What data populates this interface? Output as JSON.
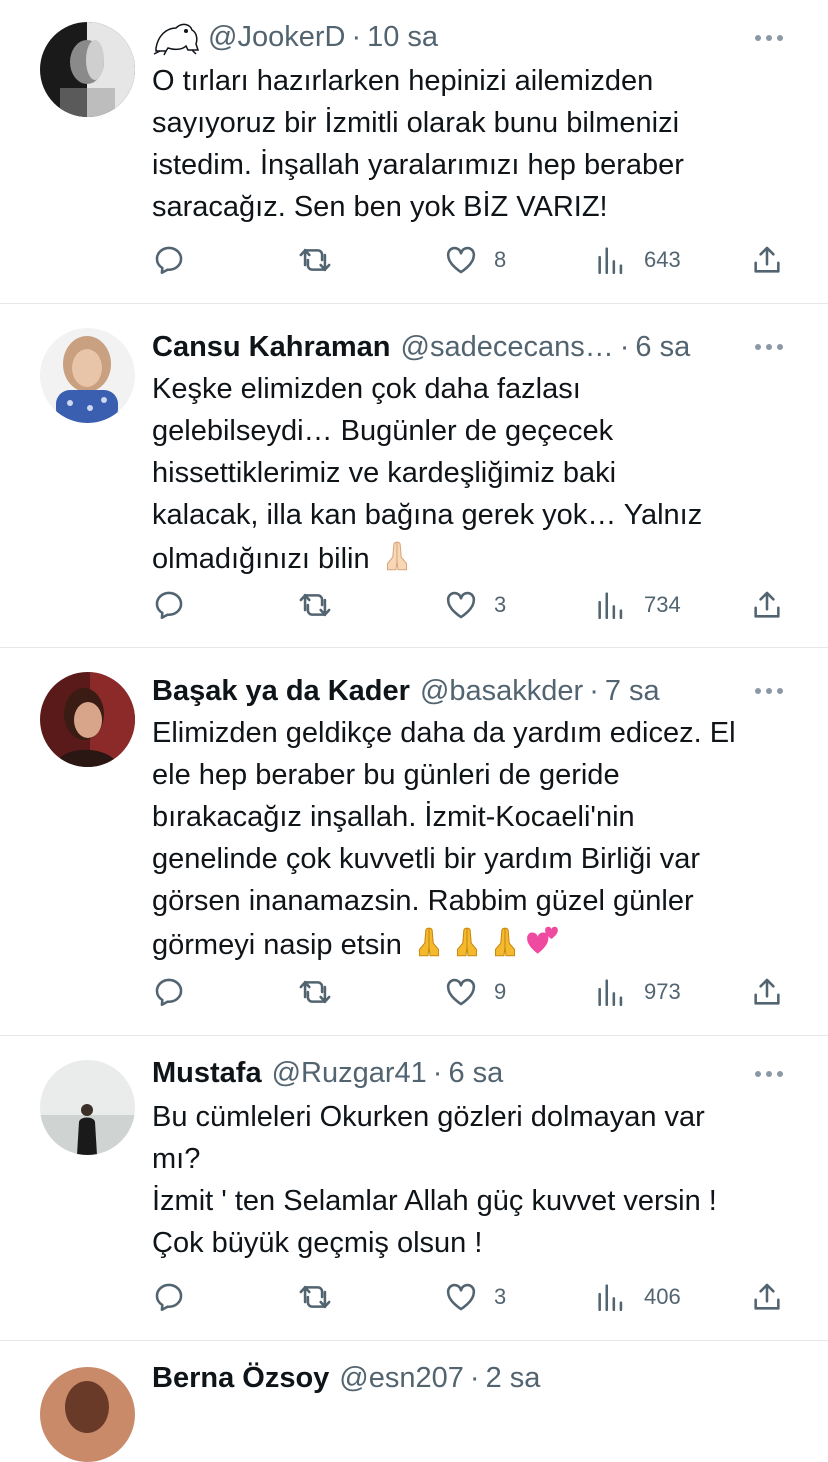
{
  "tweets": [
    {
      "name": "",
      "handle": "@JookerD",
      "separator": "·",
      "time": "10 sa",
      "text": "O tırları hazırlarken hepinizi ailemizden\nsayıyoruz bir İzmitli olarak bunu bilmenizi\nistedim. İnşallah yaralarımızı hep beraber\nsaracağız. Sen ben yok BİZ VARIZ!",
      "emojis": [],
      "likes": "8",
      "views": "643"
    },
    {
      "name": "Cansu Kahraman",
      "handle": "@sadececans…",
      "separator": "·",
      "time": "6 sa",
      "text": "Keşke elimizden çok daha fazlası\ngelebilseydi… Bugünler de geçecek\nhissettiklerimiz ve kardeşliğimiz baki\nkalacak, illa kan bağına gerek yok… Yalnız\nolmadığınızı bilin",
      "emojis": [
        "folded-hands-emoji"
      ],
      "likes": "3",
      "views": "734"
    },
    {
      "name": "Başak ya da Kader",
      "handle": "@basakkder",
      "separator": "·",
      "time": "7 sa",
      "text": "Elimizden geldikçe daha da yardım edicez. El\nele hep beraber bu günleri de geride\nbırakacağız inşallah. İzmit-Kocaeli'nin\ngenelinde çok kuvvetli bir yardım Birliği var\ngörsen inanamazsin. Rabbim güzel günler\ngörmeyi nasip etsin",
      "emojis": [
        "folded-hands-emoji",
        "folded-hands-emoji",
        "folded-hands-emoji",
        "two-hearts-emoji"
      ],
      "likes": "9",
      "views": "973"
    },
    {
      "name": "Mustafa",
      "handle": "@Ruzgar41",
      "separator": "·",
      "time": "6 sa",
      "text": "Bu cümleleri Okurken gözleri dolmayan var\nmı?\nİzmit ' ten Selamlar Allah güç kuvvet versin !\nÇok büyük geçmiş olsun !",
      "emojis": [],
      "likes": "3",
      "views": "406"
    },
    {
      "name": "Berna Özsoy",
      "handle": "@esn207",
      "separator": "·",
      "time": "2 sa",
      "text": "",
      "emojis": [],
      "likes": "",
      "views": ""
    }
  ],
  "colors": {
    "text": "#0f1419",
    "secondary": "#536471",
    "divider": "#e6e9ec"
  },
  "icons": [
    "reply-icon",
    "retweet-icon",
    "like-icon",
    "views-icon",
    "share-icon",
    "more-icon"
  ]
}
